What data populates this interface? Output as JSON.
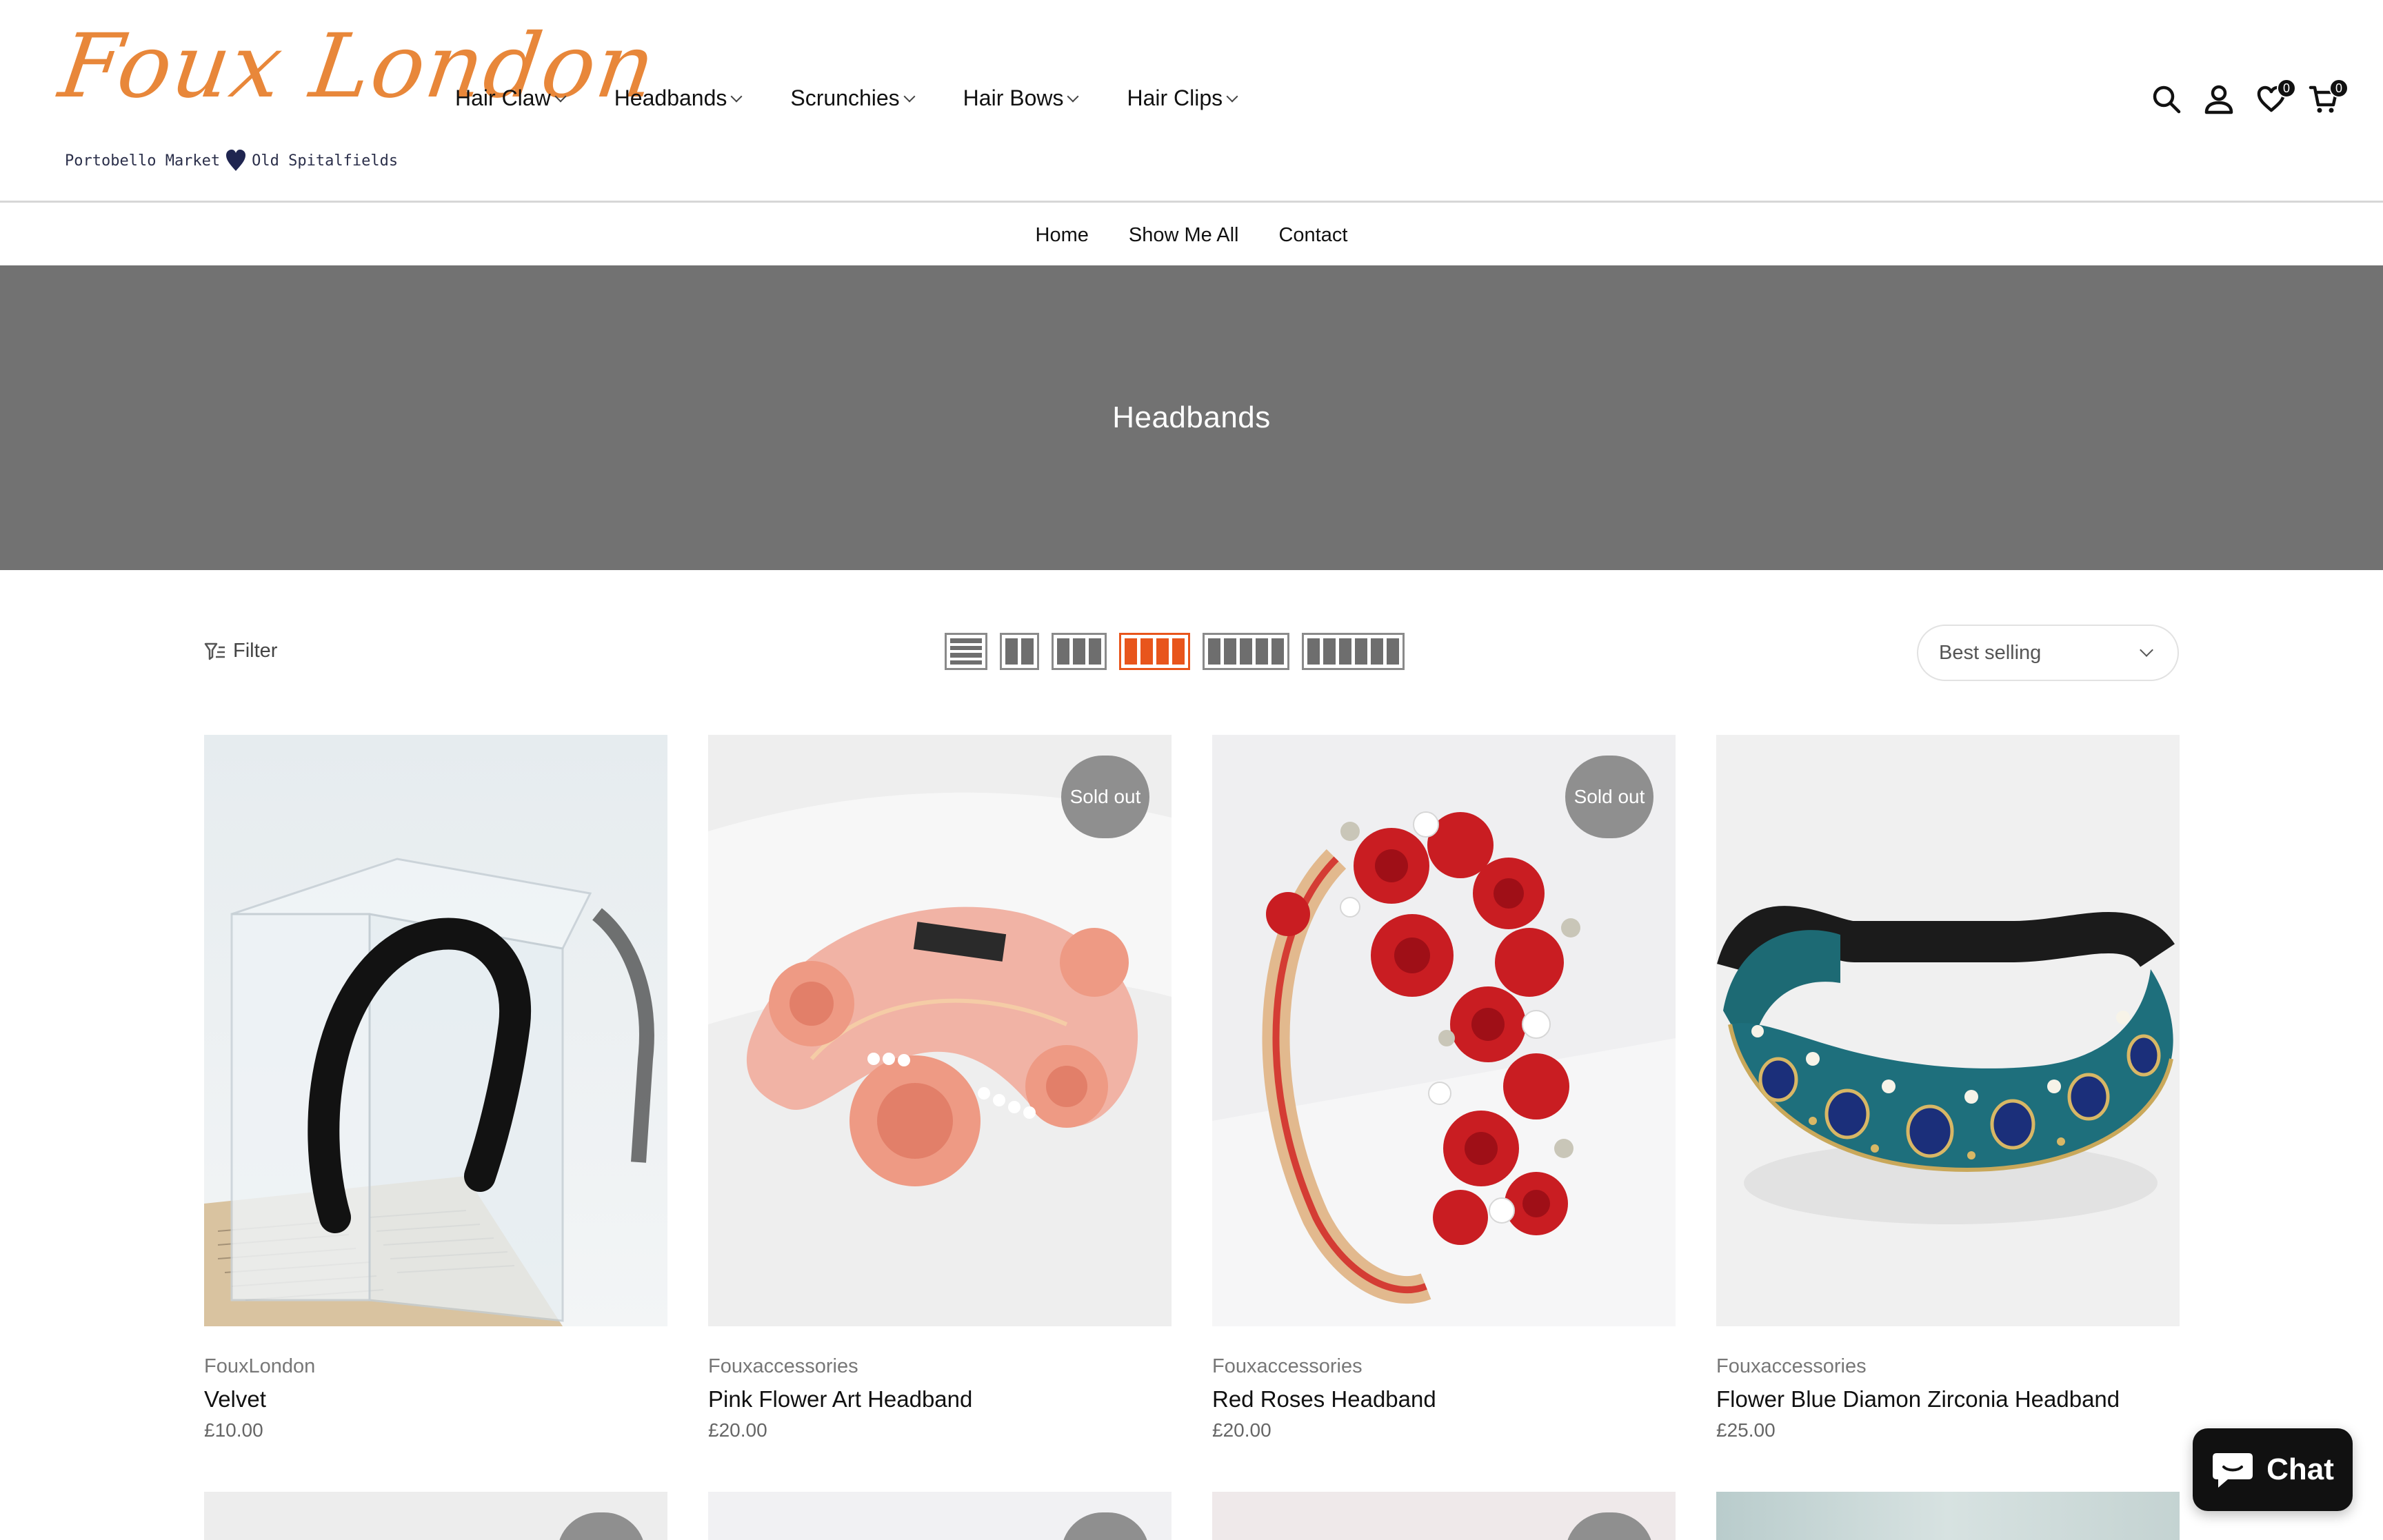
{
  "brand": {
    "logo_text": "Foux London",
    "tagline_left": "Portobello Market",
    "tagline_right": "Old Spitalfields",
    "accent_color": "#e8873a"
  },
  "main_nav": [
    {
      "label": "Hair Claw"
    },
    {
      "label": "Headbands"
    },
    {
      "label": "Scrunchies"
    },
    {
      "label": "Hair Bows"
    },
    {
      "label": "Hair Clips"
    }
  ],
  "header_icons": {
    "search": "search-icon",
    "account": "user-icon",
    "wishlist": "heart-icon",
    "wishlist_count": "0",
    "cart": "cart-icon",
    "cart_count": "0"
  },
  "sub_nav": [
    {
      "label": "Home"
    },
    {
      "label": "Show Me All"
    },
    {
      "label": "Contact"
    }
  ],
  "banner": {
    "title": "Headbands",
    "background": "#727272"
  },
  "toolbar": {
    "filter_label": "Filter",
    "layouts": [
      "list",
      "2-col",
      "3-col",
      "4-col",
      "5-col",
      "6-col"
    ],
    "active_layout": "4-col",
    "active_color": "#e8551c",
    "sort_value": "Best selling"
  },
  "products": [
    {
      "vendor": "FouxLondon",
      "title": "Velvet",
      "price": "£10.00",
      "sold_out": false,
      "badge": ""
    },
    {
      "vendor": "Fouxaccessories",
      "title": "Pink Flower Art Headband",
      "price": "£20.00",
      "sold_out": true,
      "badge": "Sold out"
    },
    {
      "vendor": "Fouxaccessories",
      "title": "Red Roses Headband",
      "price": "£20.00",
      "sold_out": true,
      "badge": "Sold out"
    },
    {
      "vendor": "Fouxaccessories",
      "title": "Flower Blue Diamon Zirconia Headband",
      "price": "£25.00",
      "sold_out": false,
      "badge": ""
    }
  ],
  "chat": {
    "label": "Chat"
  }
}
